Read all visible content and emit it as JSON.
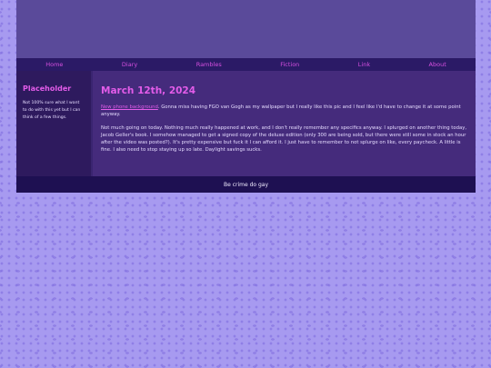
{
  "nav": {
    "items": [
      "Home",
      "Diary",
      "Rambles",
      "Fiction",
      "Link",
      "About"
    ]
  },
  "sidebar": {
    "title": "Placeholder",
    "text": "Not 100% sure what I want to do with this yet but I can think of a few things."
  },
  "post": {
    "date": "March 12th, 2024",
    "link_text": "New phone background",
    "p1_rest": ". Gonna miss having FGO van Gogh as my wallpaper but I really like this pic and I feel like I'd have to change it at some point anyway.",
    "p2": "Not much going on today. Nothing much really happened at work, and I don't really remember any specifics anyway. I splurged on another thing today, Jacob Geller's book. I somehow managed to get a signed copy of the deluxe edition (only 300 are being sold, but there were still some in stock an hour after the video was posted?). It's pretty expensive but fuck it I can afford it. I just have to remember to not splurge on like, every paycheck. A little is fine. I also need to stop staying up so late. Daylight savings sucks."
  },
  "footer": {
    "text": "Be crime do gay"
  }
}
